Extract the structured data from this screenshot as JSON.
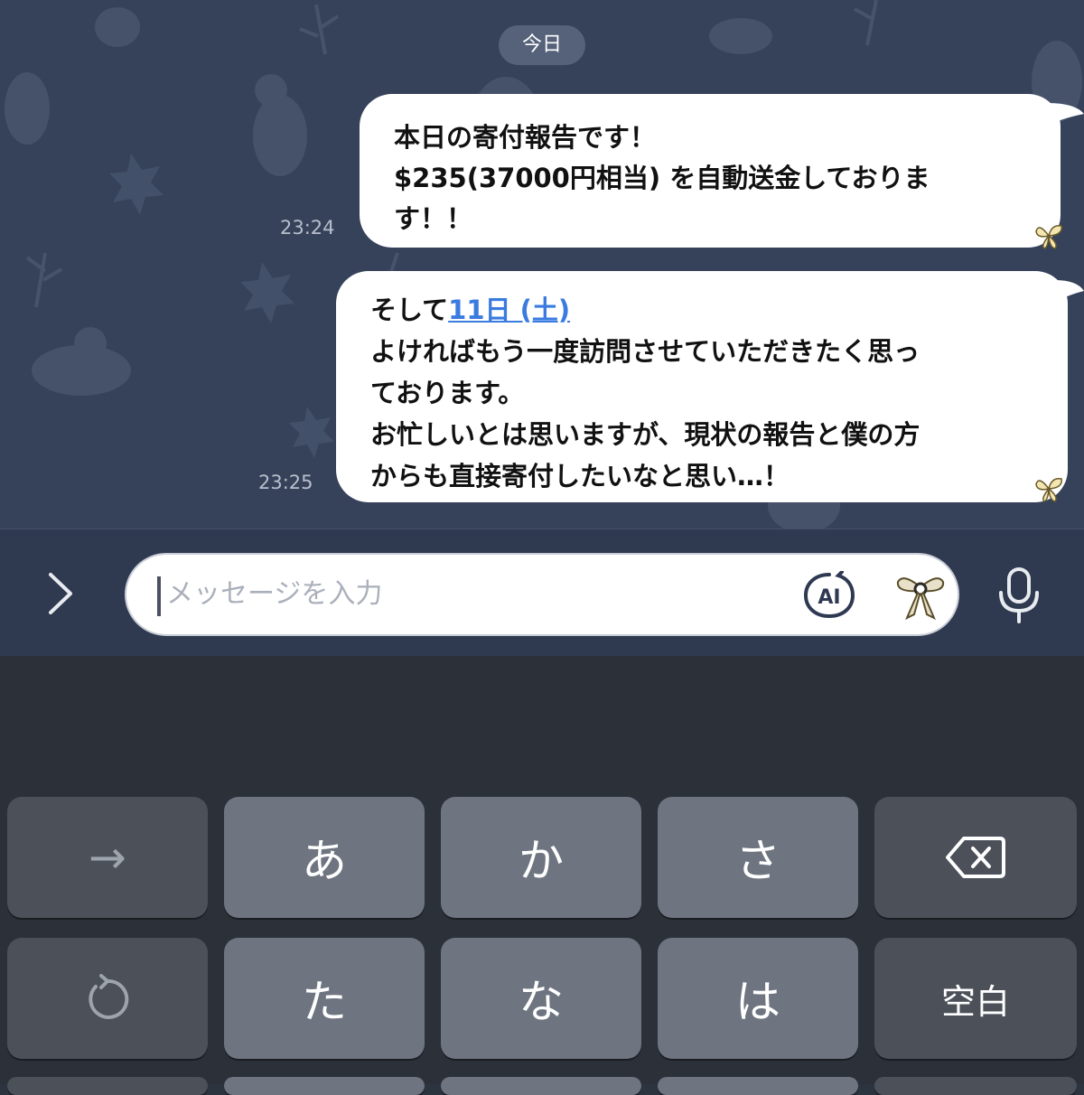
{
  "chat": {
    "date_label": "今日",
    "messages": [
      {
        "lines": [
          "本日の寄付報告です！",
          "$235(37000円相当) を自動送金しておりま",
          "す！！"
        ],
        "time": "23:24"
      },
      {
        "prefix": "そして",
        "link": "11日 (土)",
        "lines": [
          "よければもう一度訪問させていただきたく思っ",
          "ております。",
          "お忙しいとは思いますが、現状の報告と僕の方",
          "からも直接寄付したいなと思い…！"
        ],
        "time": "23:25"
      }
    ]
  },
  "input_bar": {
    "placeholder": "メッセージを入力",
    "ai_label": "AI"
  },
  "keyboard": {
    "row1": [
      "→",
      "あ",
      "か",
      "さ"
    ],
    "row2": [
      "た",
      "な",
      "は",
      "空白"
    ]
  },
  "icons": {
    "expand": "chevron-right-icon",
    "ai": "ai-icon",
    "sticker": "bow-sticker-icon",
    "mic": "microphone-icon",
    "backspace": "backspace-icon",
    "undo": "undo-icon",
    "reaction": "butterfly-icon"
  }
}
